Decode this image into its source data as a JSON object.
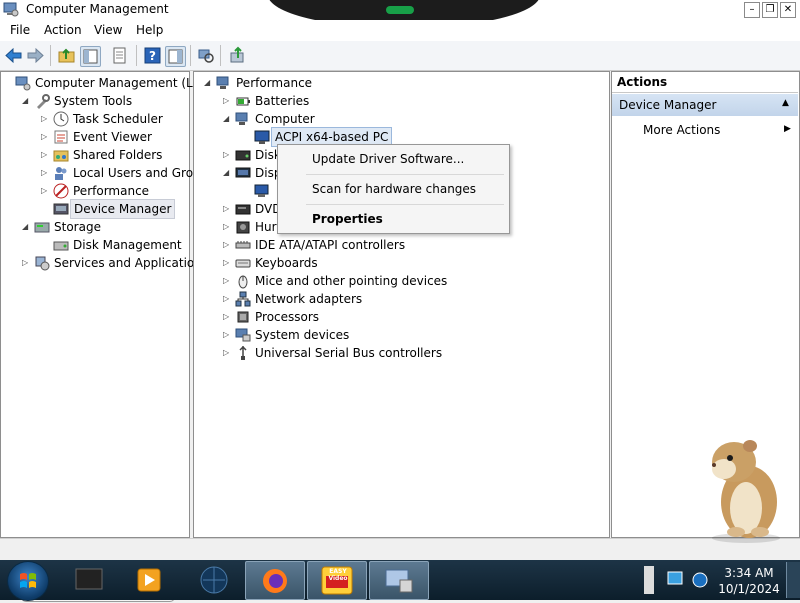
{
  "window": {
    "title": "Computer Management"
  },
  "menu": [
    "File",
    "Action",
    "View",
    "Help"
  ],
  "left_tree": [
    {
      "label": "Computer Management (Local",
      "indent": 0,
      "expander": "",
      "icon": "computer-management-icon"
    },
    {
      "label": "System Tools",
      "indent": 1,
      "expander": "◢",
      "icon": "system-tools-icon"
    },
    {
      "label": "Task Scheduler",
      "indent": 2,
      "expander": "▷",
      "icon": "clock-icon"
    },
    {
      "label": "Event Viewer",
      "indent": 2,
      "expander": "▷",
      "icon": "event-viewer-icon"
    },
    {
      "label": "Shared Folders",
      "indent": 2,
      "expander": "▷",
      "icon": "shared-folders-icon"
    },
    {
      "label": "Local Users and Groups",
      "indent": 2,
      "expander": "▷",
      "icon": "users-icon"
    },
    {
      "label": "Performance",
      "indent": 2,
      "expander": "▷",
      "icon": "performance-icon"
    },
    {
      "label": "Device Manager",
      "indent": 2,
      "expander": "",
      "icon": "device-manager-icon",
      "selected": true
    },
    {
      "label": "Storage",
      "indent": 1,
      "expander": "◢",
      "icon": "storage-icon"
    },
    {
      "label": "Disk Management",
      "indent": 2,
      "expander": "",
      "icon": "disk-management-icon"
    },
    {
      "label": "Services and Applications",
      "indent": 1,
      "expander": "▷",
      "icon": "services-icon"
    }
  ],
  "device_tree": [
    {
      "label": "Performance",
      "indent": 0,
      "expander": "◢",
      "icon": "computer-icon"
    },
    {
      "label": "Batteries",
      "indent": 1,
      "expander": "▷",
      "icon": "battery-icon"
    },
    {
      "label": "Computer",
      "indent": 1,
      "expander": "◢",
      "icon": "computer-icon"
    },
    {
      "label": "ACPI x64-based PC",
      "indent": 2,
      "expander": "",
      "icon": "monitor-icon",
      "selected": true
    },
    {
      "label": "Disk",
      "indent": 1,
      "expander": "▷",
      "icon": "disk-drive-icon"
    },
    {
      "label": "Disp",
      "indent": 1,
      "expander": "◢",
      "icon": "display-adapter-icon"
    },
    {
      "label": "",
      "indent": 2,
      "expander": "",
      "icon": "display-device-icon"
    },
    {
      "label": "DVD",
      "indent": 1,
      "expander": "▷",
      "icon": "dvd-icon"
    },
    {
      "label": "Hur",
      "indent": 1,
      "expander": "▷",
      "icon": "hid-icon"
    },
    {
      "label": "IDE ATA/ATAPI controllers",
      "indent": 1,
      "expander": "▷",
      "icon": "ide-icon"
    },
    {
      "label": "Keyboards",
      "indent": 1,
      "expander": "▷",
      "icon": "keyboard-icon"
    },
    {
      "label": "Mice and other pointing devices",
      "indent": 1,
      "expander": "▷",
      "icon": "mouse-icon"
    },
    {
      "label": "Network adapters",
      "indent": 1,
      "expander": "▷",
      "icon": "network-icon"
    },
    {
      "label": "Processors",
      "indent": 1,
      "expander": "▷",
      "icon": "processor-icon"
    },
    {
      "label": "System devices",
      "indent": 1,
      "expander": "▷",
      "icon": "system-devices-icon"
    },
    {
      "label": "Universal Serial Bus controllers",
      "indent": 1,
      "expander": "▷",
      "icon": "usb-icon"
    }
  ],
  "context_menu": {
    "update": "Update Driver Software...",
    "scan": "Scan for hardware changes",
    "properties": "Properties"
  },
  "actions": {
    "header": "Actions",
    "section": "Device Manager",
    "more": "More Actions",
    "more_arrow": "▶",
    "collapse_arrow": "▲"
  },
  "taskbar": {
    "time": "3:34 AM",
    "date": "10/1/2024",
    "video_badge": "EASY Video"
  },
  "colors": {
    "taskbar": "#102838",
    "selection": "#dfe9f5",
    "actions_section": "#c9d9ec"
  }
}
